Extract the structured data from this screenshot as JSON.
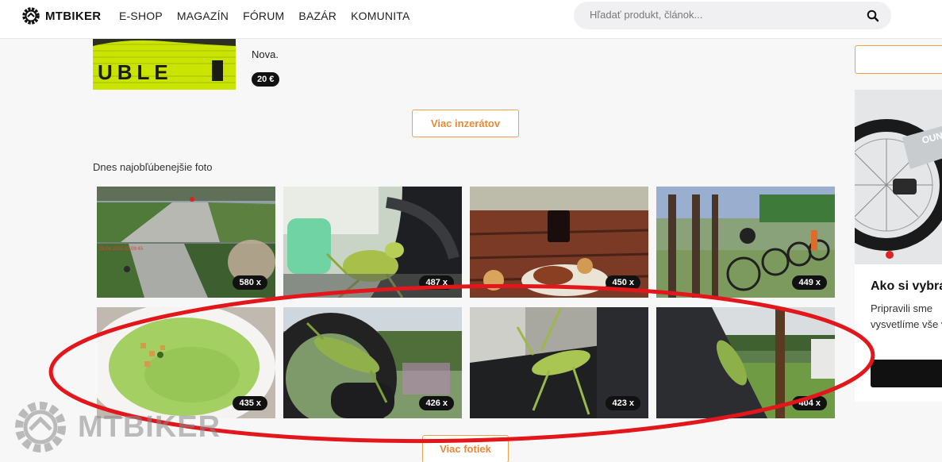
{
  "header": {
    "logo_text": "MTBIKER",
    "nav": [
      {
        "label": "E-SHOP"
      },
      {
        "label": "MAGAZÍN"
      },
      {
        "label": "FÓRUM"
      },
      {
        "label": "BAZÁR"
      },
      {
        "label": "KOMUNITA"
      }
    ],
    "search_placeholder": "Hľadať produkt, článok..."
  },
  "listing": {
    "image_text": "UBLE",
    "description": "Nova.",
    "price": "20 €"
  },
  "more_ads_label": "Viac inzerátov",
  "photos_section": {
    "title": "Dnes najobľúbenejšie foto",
    "photos": [
      {
        "views": "580 x",
        "subject": "bike path"
      },
      {
        "views": "487 x",
        "subject": "grasshopper"
      },
      {
        "views": "450 x",
        "subject": "food on table"
      },
      {
        "views": "449 x",
        "subject": "bike rack"
      },
      {
        "views": "435 x",
        "subject": "green soup"
      },
      {
        "views": "426 x",
        "subject": "grasshopper on tire"
      },
      {
        "views": "423 x",
        "subject": "grasshopper on handlebar"
      },
      {
        "views": "404 x",
        "subject": "grasshopper on frame"
      }
    ],
    "more_label": "Viac fotiek",
    "overlay_timestamp": "18.06.2023 02:09:45"
  },
  "sidebar": {
    "card_title": "Ako si vybra",
    "card_text": "Pripravili sme vysvetlíme vše vybrať.",
    "bike_brand": "OUND"
  },
  "watermark_text": "MTBIKER",
  "colors": {
    "accent_orange": "#e8893a",
    "annotation_red": "#e3161b",
    "badge_black": "#111111"
  }
}
